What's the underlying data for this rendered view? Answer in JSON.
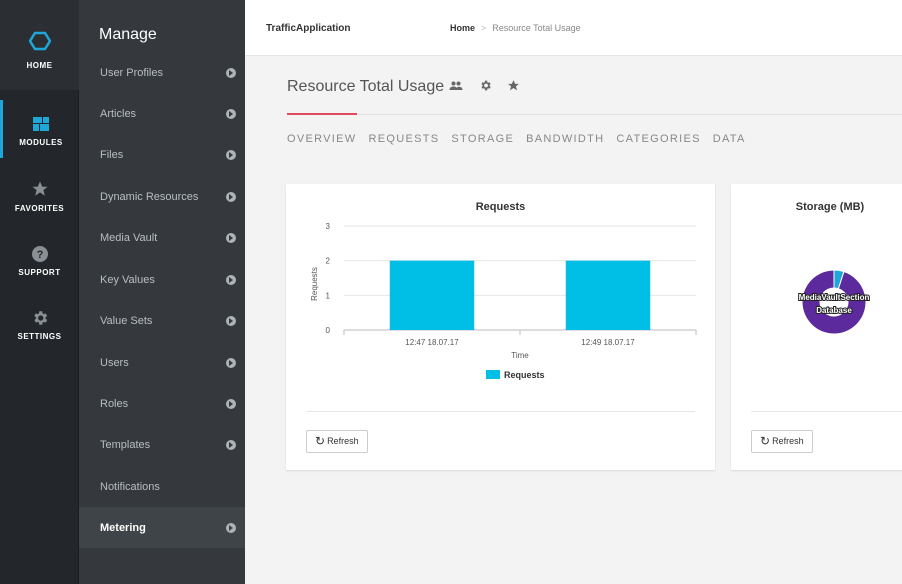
{
  "rail": {
    "items": [
      {
        "label": "HOME",
        "icon": "hexagon-icon"
      },
      {
        "label": "MODULES",
        "icon": "modules-icon"
      },
      {
        "label": "FAVORITES",
        "icon": "star-icon"
      },
      {
        "label": "SUPPORT",
        "icon": "help-icon"
      },
      {
        "label": "SETTINGS",
        "icon": "gear-icon"
      }
    ],
    "accent": "#1ea7d8"
  },
  "sidebar": {
    "title": "Manage",
    "items": [
      {
        "label": "User Profiles"
      },
      {
        "label": "Articles"
      },
      {
        "label": "Files"
      },
      {
        "label": "Dynamic Resources"
      },
      {
        "label": "Media Vault"
      },
      {
        "label": "Key Values"
      },
      {
        "label": "Value Sets"
      },
      {
        "label": "Users"
      },
      {
        "label": "Roles"
      },
      {
        "label": "Templates"
      },
      {
        "label": "Notifications"
      },
      {
        "label": "Metering"
      }
    ]
  },
  "header": {
    "app_name": "TrafficApplication",
    "breadcrumb": {
      "home": "Home",
      "separator": ">",
      "current": "Resource Total Usage"
    }
  },
  "page": {
    "title": "Resource Total Usage",
    "tabs": [
      "OVERVIEW",
      "REQUESTS",
      "STORAGE",
      "BANDWIDTH",
      "CATEGORIES",
      "DATA"
    ],
    "accent": "#e24a5c"
  },
  "cards": {
    "requests": {
      "refresh_label": "Refresh"
    },
    "storage": {
      "refresh_label": "Refresh"
    }
  },
  "chart_data": [
    {
      "type": "bar",
      "title": "Requests",
      "categories": [
        "12:47 18.07.17",
        "12:49 18.07.17"
      ],
      "series": [
        {
          "name": "Requests",
          "values": [
            2,
            2
          ],
          "color": "#00bfe6"
        }
      ],
      "xlabel": "Time",
      "ylabel": "Requests",
      "ylim": [
        0,
        3
      ],
      "yticks": [
        0,
        1,
        2,
        3
      ],
      "grid": true,
      "legend": "bottom"
    },
    {
      "type": "pie",
      "title": "Storage (MB)",
      "labels": [
        "MediaVaultSection",
        "Database"
      ],
      "values": [
        95,
        5
      ],
      "colors": [
        "#5c2a9d",
        "#1ea7d8"
      ]
    }
  ]
}
